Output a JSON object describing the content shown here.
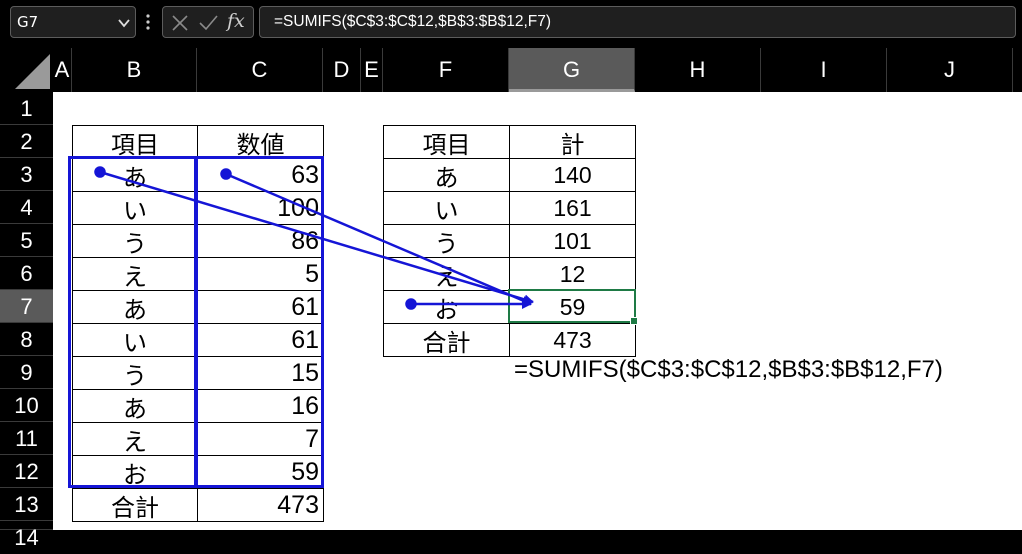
{
  "namebox": {
    "value": "G7"
  },
  "formula_bar": {
    "text": "=SUMIFS($C$3:$C$12,$B$3:$B$12,F7)",
    "fx_label": "fx"
  },
  "columns": [
    "A",
    "B",
    "C",
    "D",
    "E",
    "F",
    "G",
    "H",
    "I",
    "J"
  ],
  "rows": [
    "1",
    "2",
    "3",
    "4",
    "5",
    "6",
    "7",
    "8",
    "9",
    "10",
    "11",
    "12",
    "13",
    "14"
  ],
  "selected": {
    "column": "G",
    "row": "7"
  },
  "left_table": {
    "headers": [
      "項目",
      "数値"
    ],
    "rows": [
      [
        "あ",
        "63"
      ],
      [
        "い",
        "100"
      ],
      [
        "う",
        "86"
      ],
      [
        "え",
        "5"
      ],
      [
        "あ",
        "61"
      ],
      [
        "い",
        "61"
      ],
      [
        "う",
        "15"
      ],
      [
        "あ",
        "16"
      ],
      [
        "え",
        "7"
      ],
      [
        "お",
        "59"
      ]
    ],
    "total": [
      "合計",
      "473"
    ]
  },
  "right_table": {
    "headers": [
      "項目",
      "計"
    ],
    "rows": [
      [
        "あ",
        "140"
      ],
      [
        "い",
        "161"
      ],
      [
        "う",
        "101"
      ],
      [
        "え",
        "12"
      ],
      [
        "お",
        "59"
      ]
    ],
    "total": [
      "合計",
      "473"
    ]
  },
  "annotation": {
    "formula": "=SUMIFS($C$3:$C$12,$B$3:$B$12,F7)"
  },
  "colors": {
    "arrow": "#1515d6",
    "active_cell": "#1e7a45",
    "header_selected": "#5a5a5a"
  },
  "icons": [
    "chevron-down-icon",
    "more-vertical-icon",
    "cancel-x-icon",
    "confirm-check-icon",
    "function-fx-icon"
  ]
}
